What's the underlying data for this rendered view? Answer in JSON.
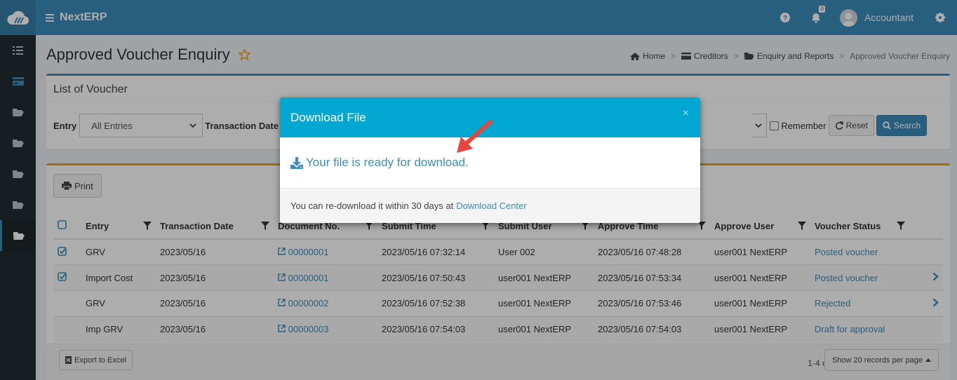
{
  "app": {
    "name": "NextERP"
  },
  "topbar": {
    "notif_count": "0",
    "user": "Accountant"
  },
  "page": {
    "title": "Approved Voucher Enquiry"
  },
  "breadcrumb": [
    "Home",
    "Creditors",
    "Enquiry and Reports",
    "Approved Voucher Enquiry"
  ],
  "list": {
    "title": "List of Voucher"
  },
  "filters": {
    "entry_label": "Entry",
    "entry_value": "All Entries",
    "date_label": "Transaction Date",
    "remember_label": "Remember",
    "reset_label": "Reset",
    "search_label": "Search"
  },
  "print_label": "Print",
  "table": {
    "headers": [
      "Entry",
      "Transaction Date",
      "Document No.",
      "Submit Time",
      "Submit User",
      "Approve Time",
      "Approve User",
      "Voucher Status"
    ],
    "rows": [
      {
        "checked": true,
        "entry": "GRV",
        "date": "2023/05/16",
        "doc": "00000001",
        "submit_time": "2023/05/16 07:32:14",
        "submit_user": "User 002",
        "approve_time": "2023/05/16 07:48:28",
        "approve_user": "user001 NextERP",
        "status": "Posted voucher",
        "chevron": false
      },
      {
        "checked": true,
        "entry": "Import Cost",
        "date": "2023/05/16",
        "doc": "00000001",
        "submit_time": "2023/05/16 07:50:43",
        "submit_user": "user001 NextERP",
        "approve_time": "2023/05/16 07:53:34",
        "approve_user": "user001 NextERP",
        "status": "Posted voucher",
        "chevron": true
      },
      {
        "checked": false,
        "entry": "GRV",
        "date": "2023/05/16",
        "doc": "00000002",
        "submit_time": "2023/05/16 07:52:38",
        "submit_user": "user001 NextERP",
        "approve_time": "2023/05/16 07:53:46",
        "approve_user": "user001 NextERP",
        "status": "Rejected",
        "chevron": true
      },
      {
        "checked": false,
        "entry": "Imp GRV",
        "date": "2023/05/16",
        "doc": "00000003",
        "submit_time": "2023/05/16 07:54:03",
        "submit_user": "user001 NextERP",
        "approve_time": "2023/05/16 07:54:03",
        "approve_user": "user001 NextERP",
        "status": "Draft for approval",
        "chevron": false
      }
    ]
  },
  "footer": {
    "export_label": "Export to Excel",
    "count": "1-4 of 4",
    "per_page": "Show 20 records per page"
  },
  "modal": {
    "title": "Download File",
    "close": "×",
    "ready_text": "Your file is ready for download.",
    "note_text": "You can re-download it within 30 days at",
    "note_link": "Download Center"
  },
  "colors": {
    "primary": "#3c8dbc",
    "modal_header": "#00a7d0",
    "sidebar": "#222d32",
    "arrow": "#e8453c"
  }
}
